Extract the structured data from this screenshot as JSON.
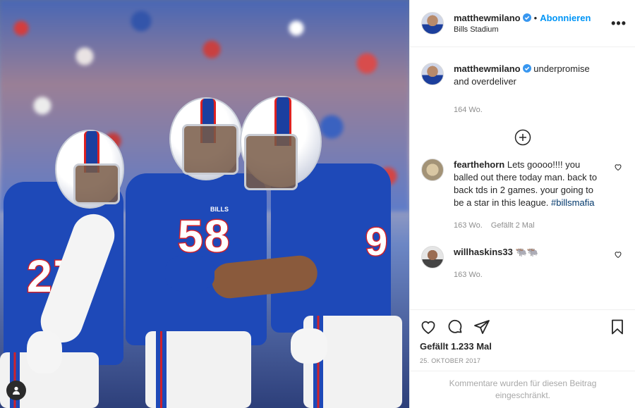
{
  "post": {
    "username": "matthewmilano",
    "follow_label": "Abonnieren",
    "location": "Bills Stadium",
    "caption": "underpromise and overdeliver",
    "caption_age": "164 Wo.",
    "likes": "Gefällt 1.233 Mal",
    "date": "25. OKTOBER 2017",
    "comments_restricted": "Kommentare wurden für diesen Beitrag eingeschränkt."
  },
  "photo": {
    "jersey_left": "27",
    "jersey_center": "58",
    "jersey_right": "9",
    "team_mark": "BILLS"
  },
  "comments": [
    {
      "username": "fearthehorn",
      "text": "Lets goooo!!!! you balled out there today man. back to back tds in 2 games. your going to be a star in this league.",
      "hashtag": "#billsmafia",
      "age": "163 Wo.",
      "likes": "Gefällt 2 Mal"
    },
    {
      "username": "willhaskins33",
      "text": "🐃🐃",
      "age": "163 Wo."
    }
  ],
  "icons": {
    "more": "more-options-icon",
    "verified": "verified-badge-icon",
    "load_more": "plus-circle-icon",
    "like": "heart-icon",
    "comment": "comment-icon",
    "share": "share-icon",
    "save": "bookmark-icon",
    "user": "user-icon"
  },
  "colors": {
    "accent": "#0095f6",
    "verified": "#3897f0",
    "bills_blue": "#1e49b8",
    "bills_red": "#d0222b",
    "muted_text": "#8e8e8e"
  }
}
